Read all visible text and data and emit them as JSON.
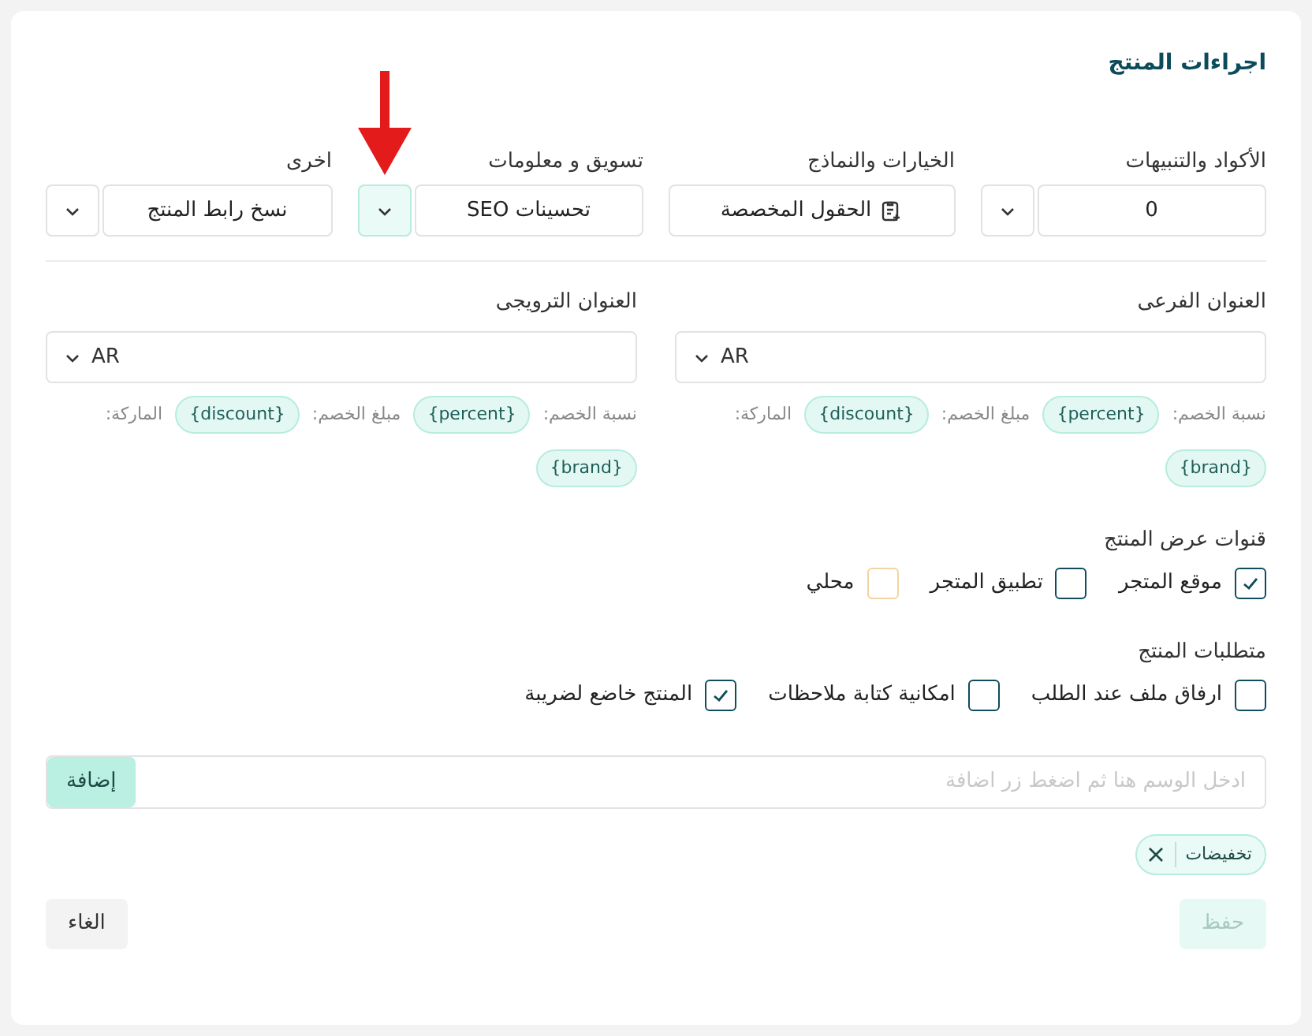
{
  "title": "اجراءات المنتج",
  "action_groups": [
    {
      "label": "الأكواد والتنبيهات",
      "kind": "split",
      "text": "0",
      "dropdown_highlighted": false
    },
    {
      "label": "الخيارات والنماذج",
      "kind": "icon_button",
      "text": "الحقول المخصصة"
    },
    {
      "label": "تسويق و معلومات",
      "kind": "split",
      "text": "تحسينات SEO",
      "dropdown_highlighted": true
    },
    {
      "label": "اخرى",
      "kind": "split",
      "text": "نسخ رابط المنتج",
      "dropdown_highlighted": false
    }
  ],
  "title_fields": [
    {
      "label": "العنوان الفرعى",
      "language": "AR",
      "variables": [
        {
          "label": "نسبة الخصم:",
          "token": "{percent}"
        },
        {
          "label": "مبلغ الخصم:",
          "token": "{discount}"
        },
        {
          "label": "الماركة:",
          "token": "{brand}"
        }
      ]
    },
    {
      "label": "العنوان الترويجى",
      "language": "AR",
      "variables": [
        {
          "label": "نسبة الخصم:",
          "token": "{percent}"
        },
        {
          "label": "مبلغ الخصم:",
          "token": "{discount}"
        },
        {
          "label": "الماركة:",
          "token": "{brand}"
        }
      ]
    }
  ],
  "checkbox_groups": [
    {
      "label": "قنوات عرض المنتج",
      "options": [
        {
          "label": "موقع المتجر",
          "checked": true,
          "color": "#0f4c5c"
        },
        {
          "label": "تطبيق المتجر",
          "checked": false,
          "color": "#0f4c5c"
        },
        {
          "label": "محلي",
          "checked": false,
          "color": "#f2d3a2"
        }
      ]
    },
    {
      "label": "متطلبات المنتج",
      "options": [
        {
          "label": "ارفاق ملف عند الطلب",
          "checked": false,
          "color": "#0f4c5c"
        },
        {
          "label": "امكانية كتابة ملاحظات",
          "checked": false,
          "color": "#0f4c5c"
        },
        {
          "label": "المنتج خاضع لضريبة",
          "checked": true,
          "color": "#0f4c5c"
        }
      ]
    }
  ],
  "tag_input": {
    "placeholder": "ادخل الوسم هنا ثم اضغط زر اضافة",
    "button": "إضافة"
  },
  "tags": [
    "تخفيضات"
  ],
  "save_button": {
    "label": "حفظ",
    "disabled": true
  },
  "cancel_button": {
    "label": "الغاء"
  }
}
